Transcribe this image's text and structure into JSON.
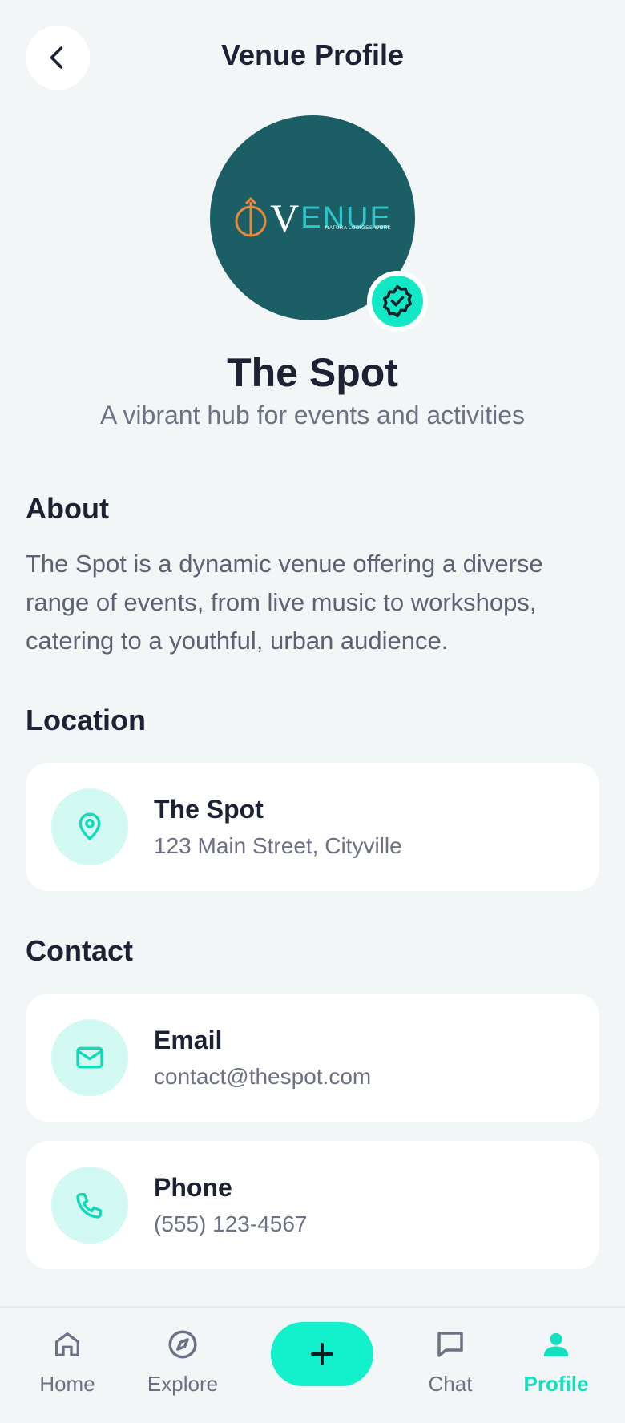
{
  "header": {
    "title": "Venue Profile",
    "back_icon": "chevron-left-icon"
  },
  "venue": {
    "logo_text": "ENUE",
    "logo_v": "V",
    "logo_subtext": "NATURA LODIGES WORK",
    "name": "The Spot",
    "tagline": "A vibrant hub for events and activities",
    "verified_icon": "verified-badge-icon"
  },
  "about": {
    "title": "About",
    "text": "The Spot is a dynamic venue offering a diverse range of events, from live music to workshops, catering to a youthful, urban audience."
  },
  "location": {
    "title": "Location",
    "name": "The Spot",
    "address": "123 Main Street, Cityville",
    "icon": "map-pin-icon"
  },
  "contact": {
    "title": "Contact",
    "email_label": "Email",
    "email_value": "contact@thespot.com",
    "email_icon": "mail-icon",
    "phone_label": "Phone",
    "phone_value": "(555) 123-4567",
    "phone_icon": "phone-icon"
  },
  "nav": {
    "items": [
      {
        "label": "Home",
        "icon": "home-icon"
      },
      {
        "label": "Explore",
        "icon": "compass-icon"
      },
      {
        "label": "Chat",
        "icon": "chat-icon"
      },
      {
        "label": "Profile",
        "icon": "user-icon"
      }
    ],
    "add_icon": "plus-icon",
    "active": "Profile"
  },
  "colors": {
    "accent": "#12f0cc",
    "accent_light": "#d2faf3",
    "avatar_bg": "#1c5e66",
    "background": "#f3f6f7",
    "text_primary": "#1c2233",
    "text_secondary": "#6c7283"
  }
}
